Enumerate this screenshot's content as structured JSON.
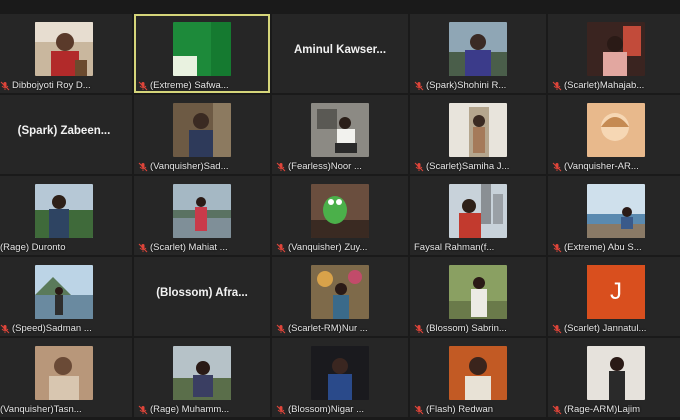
{
  "participants": [
    {
      "label": "Dibbojyoti Roy D...",
      "scene": "portrait-red",
      "muted": true
    },
    {
      "label": "(Extreme) Safwa...",
      "scene": "green-blur",
      "muted": true,
      "active": true
    },
    {
      "label": "",
      "big_name": "Aminul  Kawser...",
      "muted": false
    },
    {
      "label": "(Spark)Shohini R...",
      "scene": "lake",
      "muted": true
    },
    {
      "label": "(Scarlet)Mahajab...",
      "scene": "window-room",
      "muted": true
    },
    {
      "label": "",
      "big_name": "(Spark)  Zabeen...",
      "muted": false
    },
    {
      "label": "(Vanquisher)Sad...",
      "scene": "indoor-girl",
      "muted": true
    },
    {
      "label": "(Fearless)Noor ...",
      "scene": "indoor-sitting",
      "muted": true
    },
    {
      "label": "(Scarlet)Samiha J...",
      "scene": "doorway",
      "muted": true
    },
    {
      "label": "(Vanquisher-AR...",
      "scene": "sketch",
      "muted": true
    },
    {
      "label": "(Rage) Duronto",
      "scene": "outdoor-trees",
      "muted": false
    },
    {
      "label": "(Scarlet) Mahiat ...",
      "scene": "riverside",
      "muted": true
    },
    {
      "label": "(Vanquisher) Zuy...",
      "scene": "kermit",
      "muted": true
    },
    {
      "label": "Faysal Rahman(f...",
      "scene": "city",
      "muted": false
    },
    {
      "label": "(Extreme) Abu S...",
      "scene": "seaside",
      "muted": true
    },
    {
      "label": "(Speed)Sadman ...",
      "scene": "mountain-lake",
      "muted": true
    },
    {
      "label": "",
      "big_name": "(Blossom)  Afra...",
      "muted": false
    },
    {
      "label": "(Scarlet-RM)Nur ...",
      "scene": "decor",
      "muted": true
    },
    {
      "label": "(Blossom) Sabrin...",
      "scene": "garden",
      "muted": true
    },
    {
      "label": "(Scarlet) Jannatul...",
      "avatar_letter": "J",
      "muted": true
    },
    {
      "label": "(Vanquisher)Tasn...",
      "scene": "sepia",
      "muted": false
    },
    {
      "label": "(Rage) Muhamm...",
      "scene": "outdoor-grass",
      "muted": true
    },
    {
      "label": "(Blossom)Nigar ...",
      "scene": "dark-portrait",
      "muted": true
    },
    {
      "label": "(Flash) Redwan",
      "scene": "orange-portrait",
      "muted": true
    },
    {
      "label": "(Rage-ARM)Lajim",
      "scene": "white-wall",
      "muted": true
    }
  ],
  "colors": {
    "background": "#1a1a1a",
    "tile": "#262626",
    "active_border": "#d5d57a",
    "mute_icon": "#e0453a",
    "avatar": "#d94f1e"
  }
}
